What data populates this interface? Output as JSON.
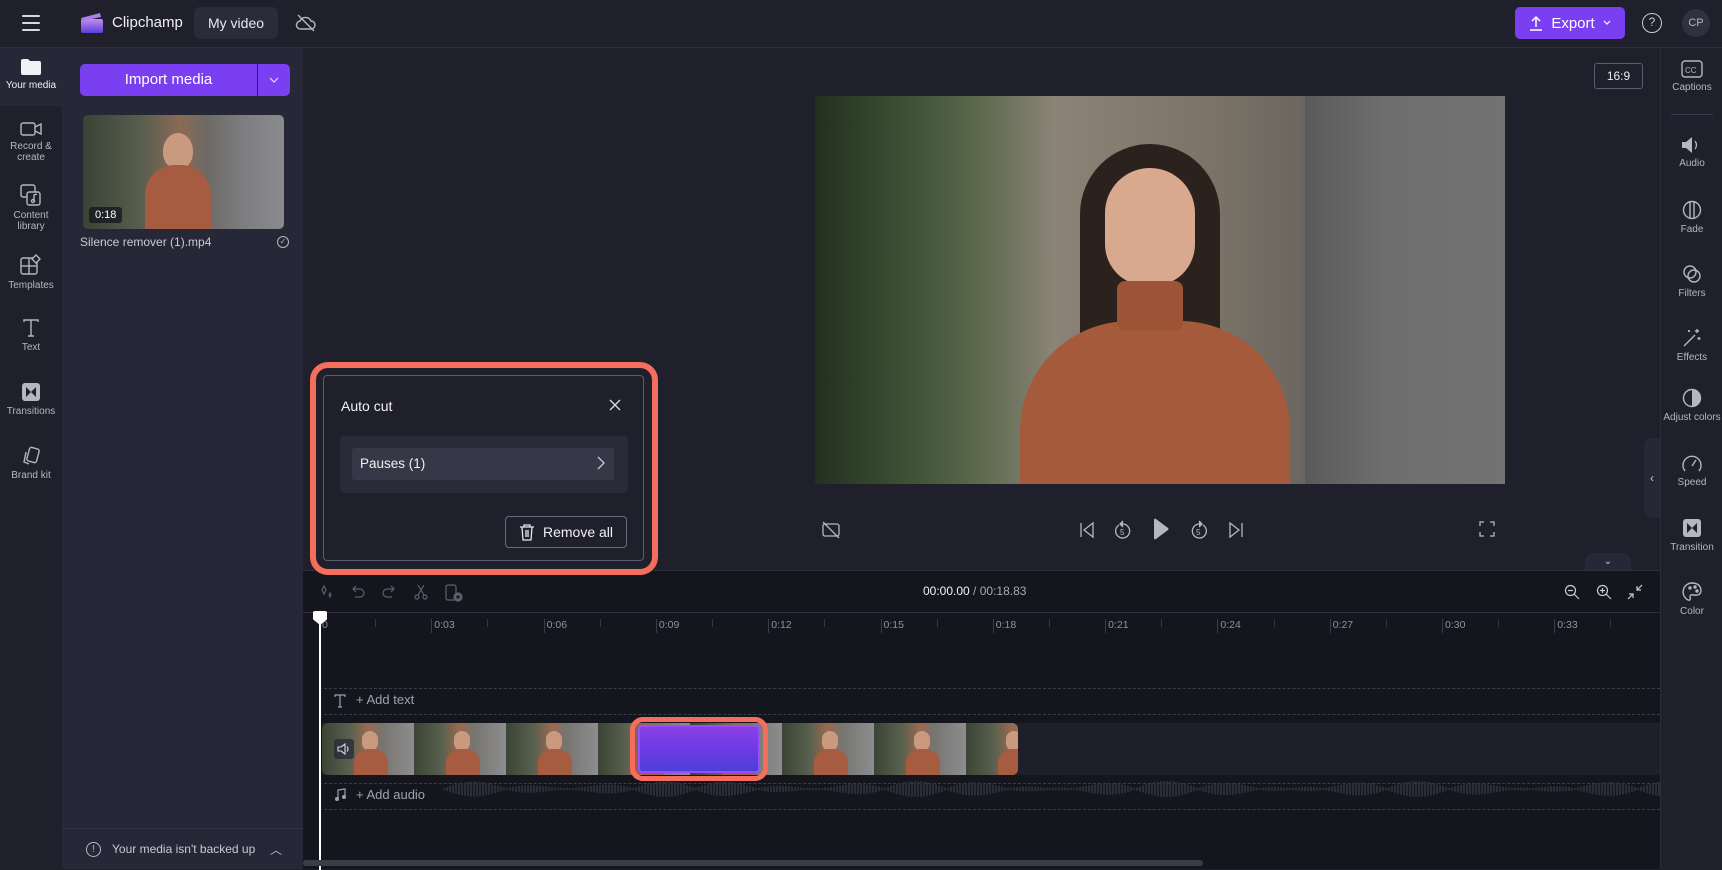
{
  "app": {
    "name": "Clipchamp",
    "project_title": "My video",
    "export_label": "Export",
    "help_label": "?",
    "avatar_initials": "CP"
  },
  "left_rail": {
    "items": [
      {
        "label": "Your media",
        "icon": "folder-icon",
        "active": true
      },
      {
        "label": "Record & create",
        "icon": "camera-icon"
      },
      {
        "label": "Content library",
        "icon": "content-library-icon"
      },
      {
        "label": "Templates",
        "icon": "templates-icon"
      },
      {
        "label": "Text",
        "icon": "text-icon"
      },
      {
        "label": "Transitions",
        "icon": "transitions-icon"
      },
      {
        "label": "Brand kit",
        "icon": "brand-kit-icon"
      }
    ]
  },
  "media_panel": {
    "import_label": "Import media",
    "items": [
      {
        "name": "Silence remover (1).mp4",
        "duration": "0:18"
      }
    ],
    "backup_notice": "Your media isn't backed up"
  },
  "preview": {
    "aspect_ratio": "16:9",
    "current_time": "00:00.00",
    "separator": " / ",
    "total_time": "00:18.83"
  },
  "right_rail": {
    "items": [
      {
        "label": "Captions",
        "icon": "captions-icon"
      },
      {
        "label": "Audio",
        "icon": "speaker-icon"
      },
      {
        "label": "Fade",
        "icon": "fade-icon"
      },
      {
        "label": "Filters",
        "icon": "filters-icon"
      },
      {
        "label": "Effects",
        "icon": "magic-wand-icon"
      },
      {
        "label": "Adjust colors",
        "icon": "adjust-colors-icon"
      },
      {
        "label": "Speed",
        "icon": "speedometer-icon"
      },
      {
        "label": "Transition",
        "icon": "transition-icon"
      },
      {
        "label": "Color",
        "icon": "palette-icon"
      }
    ]
  },
  "timeline": {
    "ruler_labels": [
      "0",
      "0:03",
      "0:06",
      "0:09",
      "0:12",
      "0:15",
      "0:18",
      "0:21",
      "0:24",
      "0:27",
      "0:30",
      "0:33"
    ],
    "add_text_label": "+ Add text",
    "add_audio_label": "+ Add audio"
  },
  "auto_cut_popup": {
    "title": "Auto cut",
    "rows": [
      {
        "label": "Pauses (1)"
      }
    ],
    "remove_all_label": "Remove all"
  },
  "colors": {
    "accent": "#7b3ff2",
    "highlight": "#f46d5d",
    "background": "#1f202b",
    "panel": "#262837",
    "timeline_bg": "#15161d"
  }
}
